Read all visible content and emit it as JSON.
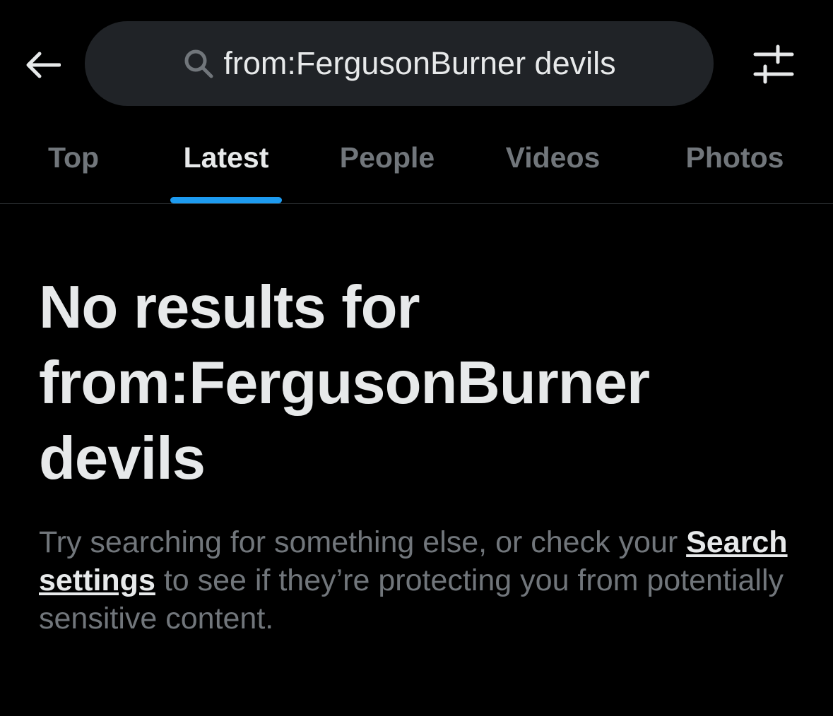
{
  "header": {
    "back_icon": "arrow-left-icon",
    "search_icon": "search-icon",
    "search_query": "from:FergusonBurner devils",
    "filter_icon": "sliders-icon"
  },
  "tabs": [
    {
      "label": "Top",
      "active": false
    },
    {
      "label": "Latest",
      "active": true
    },
    {
      "label": "People",
      "active": false
    },
    {
      "label": "Videos",
      "active": false
    },
    {
      "label": "Photos",
      "active": false
    }
  ],
  "empty_state": {
    "heading_line1": "No results for",
    "heading_line2": "from:FergusonBurner",
    "heading_line3": "devils",
    "body_before": "Try searching for something else, or check your ",
    "body_link": "Search settings",
    "body_after": " to see if they’re protecting you from potentially sensitive content."
  },
  "colors": {
    "background": "#000000",
    "accent": "#1d9bf0",
    "primary_text": "#e7e9ea",
    "secondary_text": "#71767b",
    "search_box": "#202327"
  }
}
